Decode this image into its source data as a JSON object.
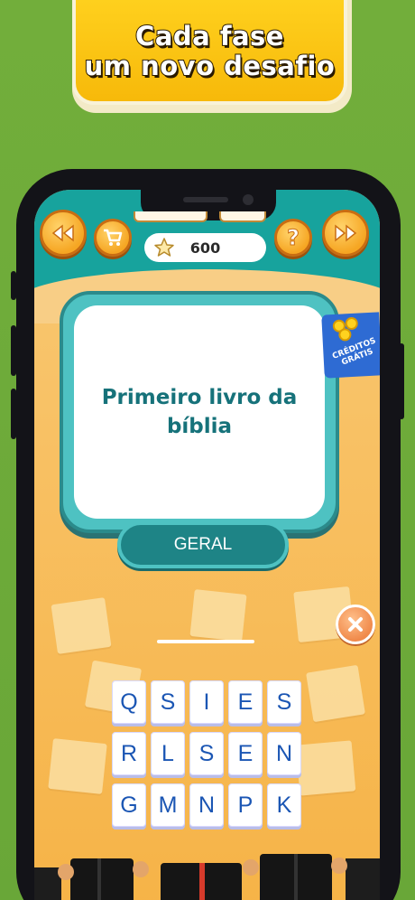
{
  "banner": {
    "line1": "Cada fase",
    "line2": "um novo desafio"
  },
  "game": {
    "score": "600",
    "question": "Primeiro livro da bíblia",
    "category": "GERAL",
    "credits_badge": "CRÉDITOS GRÁTIS",
    "letters": [
      "Q",
      "S",
      "I",
      "E",
      "S",
      "R",
      "L",
      "S",
      "E",
      "N",
      "G",
      "M",
      "N",
      "P",
      "K"
    ]
  },
  "icons": {
    "back": "rewind-icon",
    "shop": "cart-icon",
    "score": "star-icon",
    "help": "question-icon",
    "skip": "fast-forward-icon",
    "close": "close-icon"
  },
  "colors": {
    "background": "#6eab3a",
    "banner": "#f7b90a",
    "teal": "#17a39d",
    "letter": "#1b56b4",
    "question_text": "#16727a"
  }
}
